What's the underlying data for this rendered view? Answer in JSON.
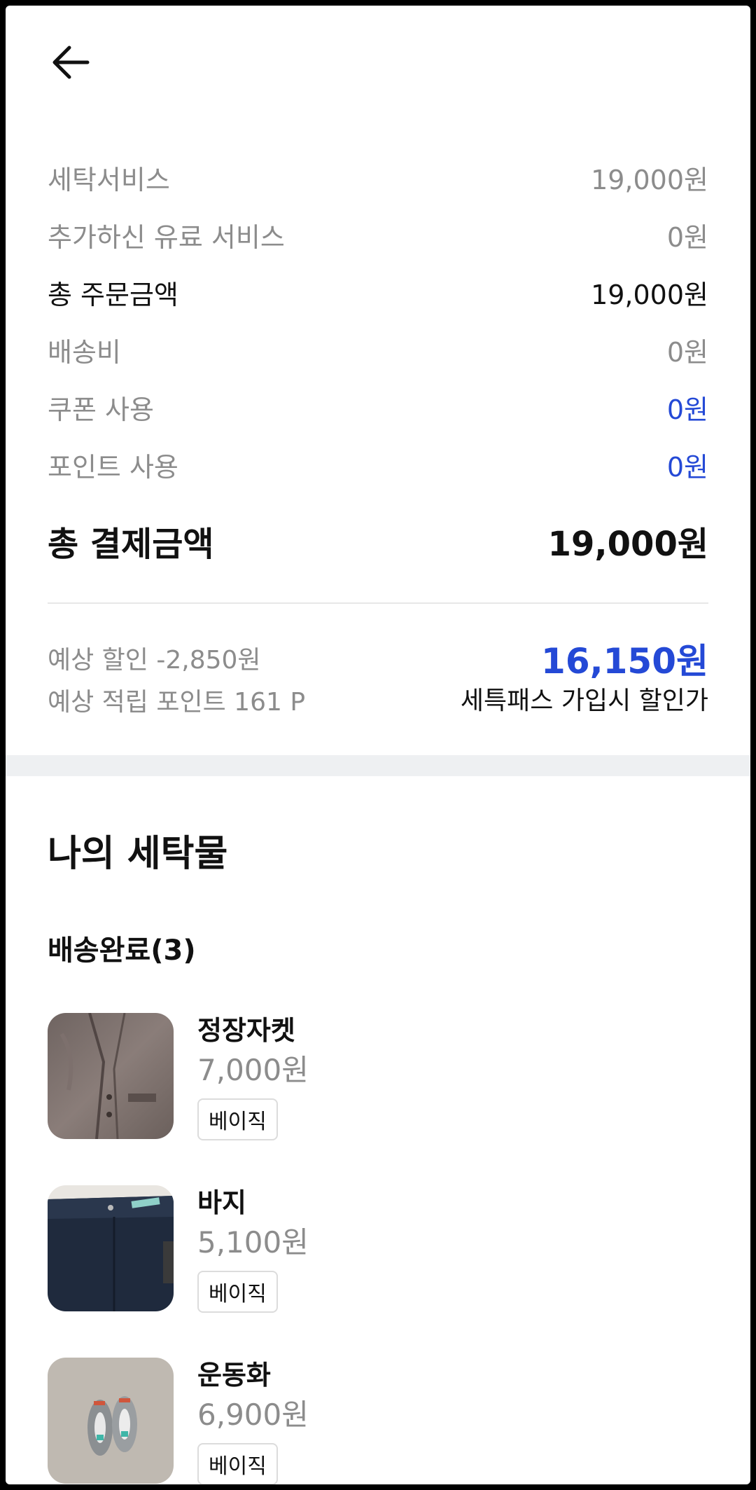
{
  "header": {
    "back_icon": "arrow-left-icon"
  },
  "summary": {
    "rows": [
      {
        "label": "세탁서비스",
        "value": "19,000원"
      },
      {
        "label": "추가하신 유료 서비스",
        "value": "0원"
      },
      {
        "label": "총 주문금액",
        "value": "19,000원"
      },
      {
        "label": "배송비",
        "value": "0원"
      },
      {
        "label": "쿠폰 사용",
        "value": "0원"
      },
      {
        "label": "포인트 사용",
        "value": "0원"
      }
    ],
    "total_label": "총 결제금액",
    "total_value": "19,000원"
  },
  "pass": {
    "discount_text": "예상 할인 -2,850원",
    "points_text": "예상 적립 포인트 161 P",
    "price": "16,150원",
    "caption": "세특패스 가입시 할인가"
  },
  "laundry": {
    "title": "나의 세탁물",
    "group_title": "배송완료(3)",
    "items": [
      {
        "name": "정장자켓",
        "price": "7,000원",
        "badge": "베이직",
        "thumb_icon": "jacket-photo"
      },
      {
        "name": "바지",
        "price": "5,100원",
        "badge": "베이직",
        "thumb_icon": "pants-photo"
      },
      {
        "name": "운동화",
        "price": "6,900원",
        "badge": "베이직",
        "thumb_icon": "sneakers-photo"
      }
    ]
  },
  "colors": {
    "accent_blue": "#2449d6",
    "muted_gray": "#8c8c8c",
    "band_gray": "#eef0f2"
  }
}
